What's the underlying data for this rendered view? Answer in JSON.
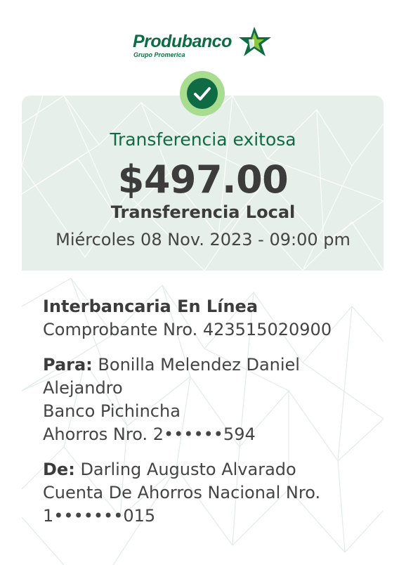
{
  "brand": {
    "name": "Produbanco",
    "subtitle": "Grupo Promerica",
    "color": "#0f6b43",
    "icon": "star-logo-icon"
  },
  "status": {
    "icon": "check-circle-icon",
    "title": "Transferencia exitosa",
    "amount": "$497.00",
    "type": "Transferencia Local",
    "datetime": "Miércoles 08 Nov. 2023 - 09:00 pm"
  },
  "details": {
    "channel": "Interbancaria En Línea",
    "receipt": "Comprobante Nro. 423515020900",
    "to_label": "Para:",
    "to_name_line1": "Bonilla Melendez Daniel",
    "to_name_line2": "Alejandro",
    "to_bank": "Banco Pichincha",
    "to_account": "Ahorros Nro. 2••••••594",
    "from_label": "De:",
    "from_name": "Darling Augusto Alvarado",
    "from_account_line1": "Cuenta De Ahorros Nacional Nro.",
    "from_account_line2": "1•••••••015"
  },
  "colors": {
    "header_bg": "#e6efe9",
    "badge_outer": "#a8dc8f",
    "badge_inner": "#0f6b43",
    "text": "#444444"
  }
}
